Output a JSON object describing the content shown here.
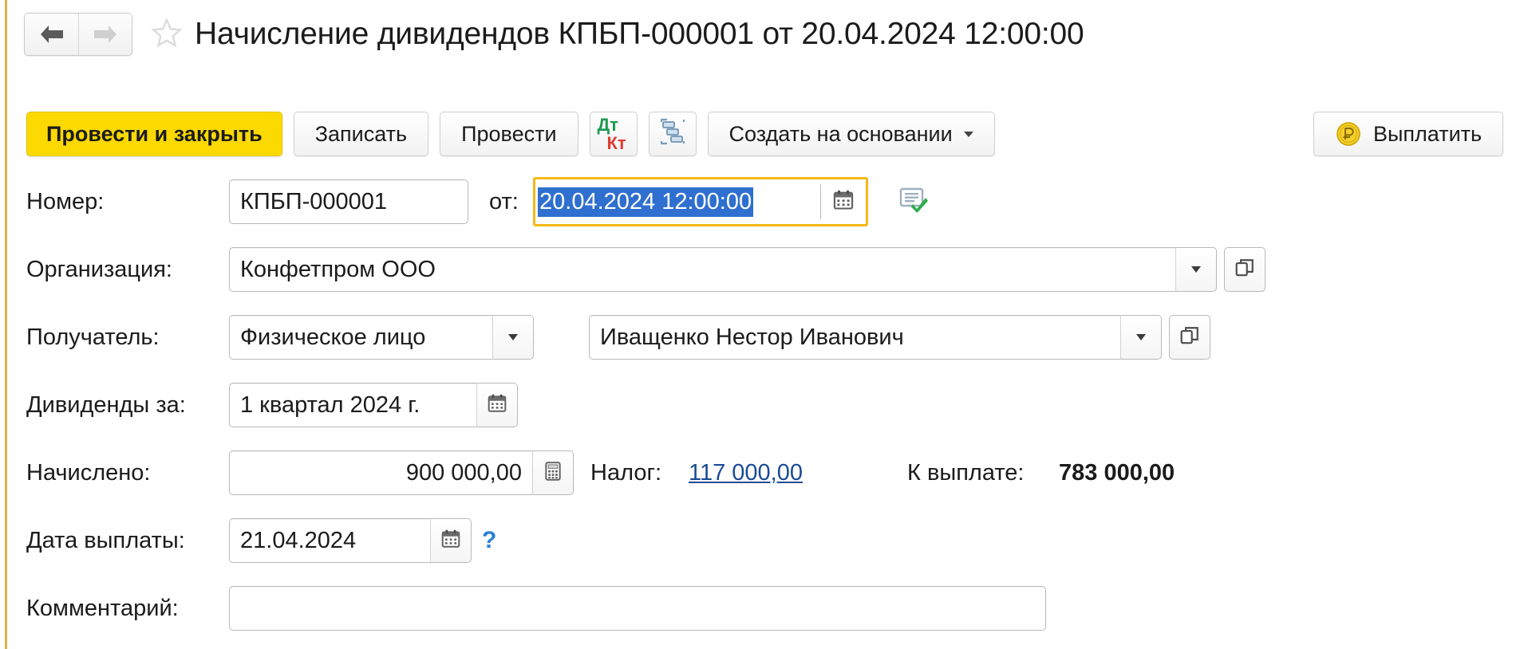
{
  "window": {
    "title": "Начисление дивидендов КПБП-000001 от 20.04.2024 12:00:00",
    "accent_gold": "#fcd900",
    "focus_border": "#f5b915",
    "selection_blue": "#2f6fd0",
    "link_blue": "#174b96"
  },
  "nav": {
    "back_icon": "arrow-left-icon",
    "forward_icon": "arrow-right-icon",
    "favorite_icon": "star-icon"
  },
  "toolbar": {
    "post_and_close": "Провести и закрыть",
    "save": "Записать",
    "post": "Провести",
    "dt_label": "Дт",
    "kt_label": "Кт",
    "structure_icon": "document-structure-icon",
    "create_based_on": "Создать на основании",
    "pay": "Выплатить",
    "pay_icon": "ruble-coin-icon"
  },
  "form": {
    "number": {
      "label": "Номер:",
      "value": "КПБП-000001",
      "date_label": "от:",
      "date_value": "20.04.2024 12:00:00",
      "calendar_icon": "calendar-icon",
      "status_icon": "document-posted-icon"
    },
    "organization": {
      "label": "Организация:",
      "value": "Конфетпром ООО",
      "dropdown_icon": "chevron-down-icon",
      "open_icon": "open-record-icon"
    },
    "recipient": {
      "label": "Получатель:",
      "type_value": "Физическое лицо",
      "name_value": "Иващенко Нестор Иванович",
      "dropdown_icon": "chevron-down-icon",
      "open_icon": "open-record-icon"
    },
    "period": {
      "label": "Дивиденды за:",
      "value": "1 квартал 2024 г.",
      "calendar_icon": "calendar-icon"
    },
    "accrued": {
      "label": "Начислено:",
      "value": "900 000,00",
      "calculator_icon": "calculator-icon",
      "tax_label": "Налог:",
      "tax_value": "117 000,00",
      "payable_label": "К выплате:",
      "payable_value": "783 000,00"
    },
    "payment_date": {
      "label": "Дата выплаты:",
      "value": "21.04.2024",
      "calendar_icon": "calendar-icon",
      "help_icon": "?"
    },
    "comment": {
      "label": "Комментарий:",
      "value": "",
      "placeholder": ""
    }
  }
}
